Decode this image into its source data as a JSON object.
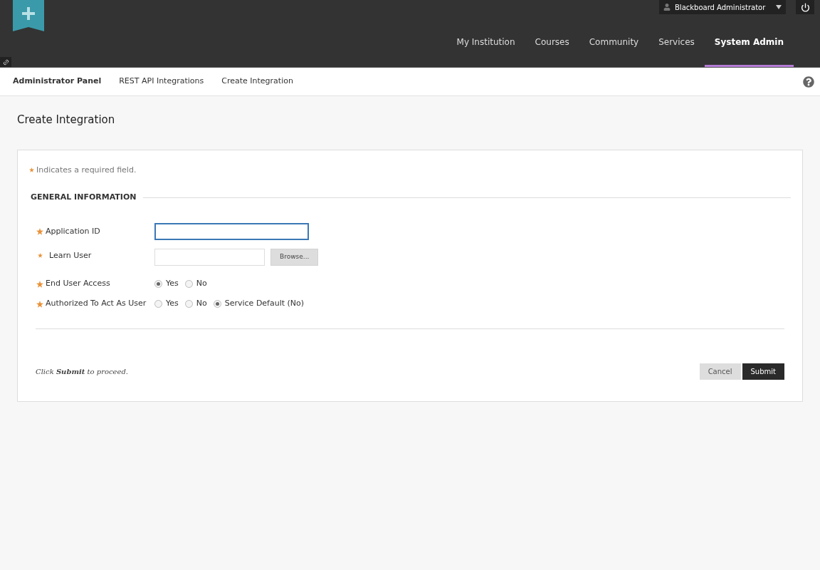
{
  "user_menu": {
    "name": "Blackboard Administrator"
  },
  "nav": [
    {
      "label": "My Institution",
      "selected": false
    },
    {
      "label": "Courses",
      "selected": false
    },
    {
      "label": "Community",
      "selected": false
    },
    {
      "label": "Services",
      "selected": false
    },
    {
      "label": "System Admin",
      "selected": true
    }
  ],
  "breadcrumbs": [
    "Administrator Panel",
    "REST API Integrations",
    "Create Integration"
  ],
  "page_title": "Create Integration",
  "required_note": "Indicates a required field.",
  "section_title": "GENERAL INFORMATION",
  "fields": [
    {
      "kind": "text",
      "label": "Application ID",
      "focused": true
    },
    {
      "kind": "picker",
      "label": "Learn User",
      "button": "Browse..."
    },
    {
      "kind": "radio",
      "label": "End User Access",
      "options": [
        {
          "label": "Yes",
          "selected": true
        },
        {
          "label": "No",
          "selected": false
        }
      ]
    },
    {
      "kind": "radio",
      "label": "Authorized To Act As User",
      "options": [
        {
          "label": "Yes",
          "selected": false
        },
        {
          "label": "No",
          "selected": false
        },
        {
          "label": "Service Default (No)",
          "selected": true
        }
      ]
    }
  ],
  "submit_hint": "Click **Submit** to proceed.",
  "buttons": [
    {
      "kind": "secondary",
      "label": "Cancel"
    },
    {
      "kind": "primary",
      "label": "Submit"
    }
  ]
}
